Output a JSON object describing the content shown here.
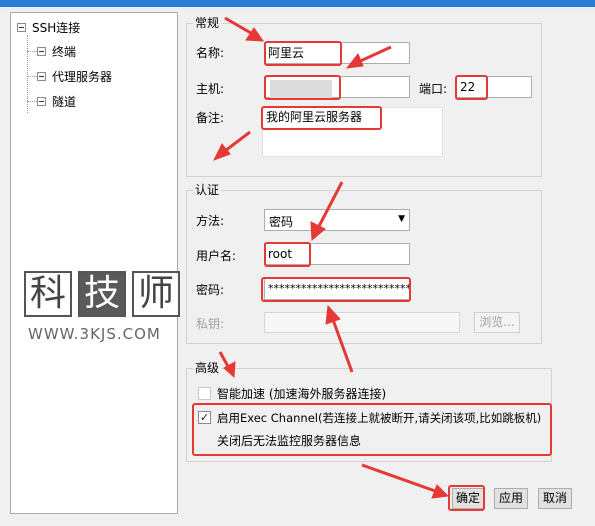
{
  "tree": {
    "root": "SSH连接",
    "items": [
      "终端",
      "代理服务器",
      "隧道"
    ]
  },
  "general": {
    "title": "常规",
    "name_label": "名称:",
    "name_value": "阿里云",
    "host_label": "主机:",
    "port_label": "端口:",
    "port_value": "22",
    "note_label": "备注:",
    "note_value": "我的阿里云服务器"
  },
  "auth": {
    "title": "认证",
    "method_label": "方法:",
    "method_value": "密码",
    "user_label": "用户名:",
    "user_value": "root",
    "password_label": "密码:",
    "password_value": "****************************",
    "key_label": "私钥:",
    "browse_label": "浏览..."
  },
  "advanced": {
    "title": "高级",
    "accel_label": "智能加速 (加速海外服务器连接)",
    "accel_checked": false,
    "exec_label": "启用Exec Channel(若连接上就被断开,请关闭该项,比如跳板机)",
    "exec_checked": true,
    "exec_note": "关闭后无法监控服务器信息"
  },
  "buttons": {
    "ok": "确定",
    "apply": "应用",
    "cancel": "取消"
  },
  "watermark": {
    "chars": [
      "科",
      "技",
      "师"
    ],
    "url": "WWW.3KJS.COM"
  },
  "colors": {
    "highlight": "#e53935",
    "title_bar": "#2b7bd3"
  }
}
